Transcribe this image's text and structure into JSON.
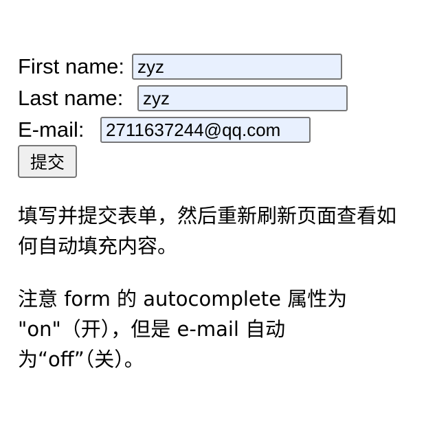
{
  "form": {
    "first_name": {
      "label": "First name:",
      "value": "zyz"
    },
    "last_name": {
      "label": "Last name:",
      "value": "zyz"
    },
    "email": {
      "label": "E-mail:",
      "value": "2711637244@qq.com"
    },
    "submit_label": "提交"
  },
  "notes": {
    "p1": "填写并提交表单，然后重新刷新页面查看如何自动填充内容。",
    "p2": "注意 form 的 autocomplete 属性为 \"on\"（开），但是 e-mail 自动为“off”（关）。"
  },
  "colors": {
    "autofill_background": "#e8f0fe",
    "field_border": "#767676",
    "button_background": "#efefef"
  }
}
